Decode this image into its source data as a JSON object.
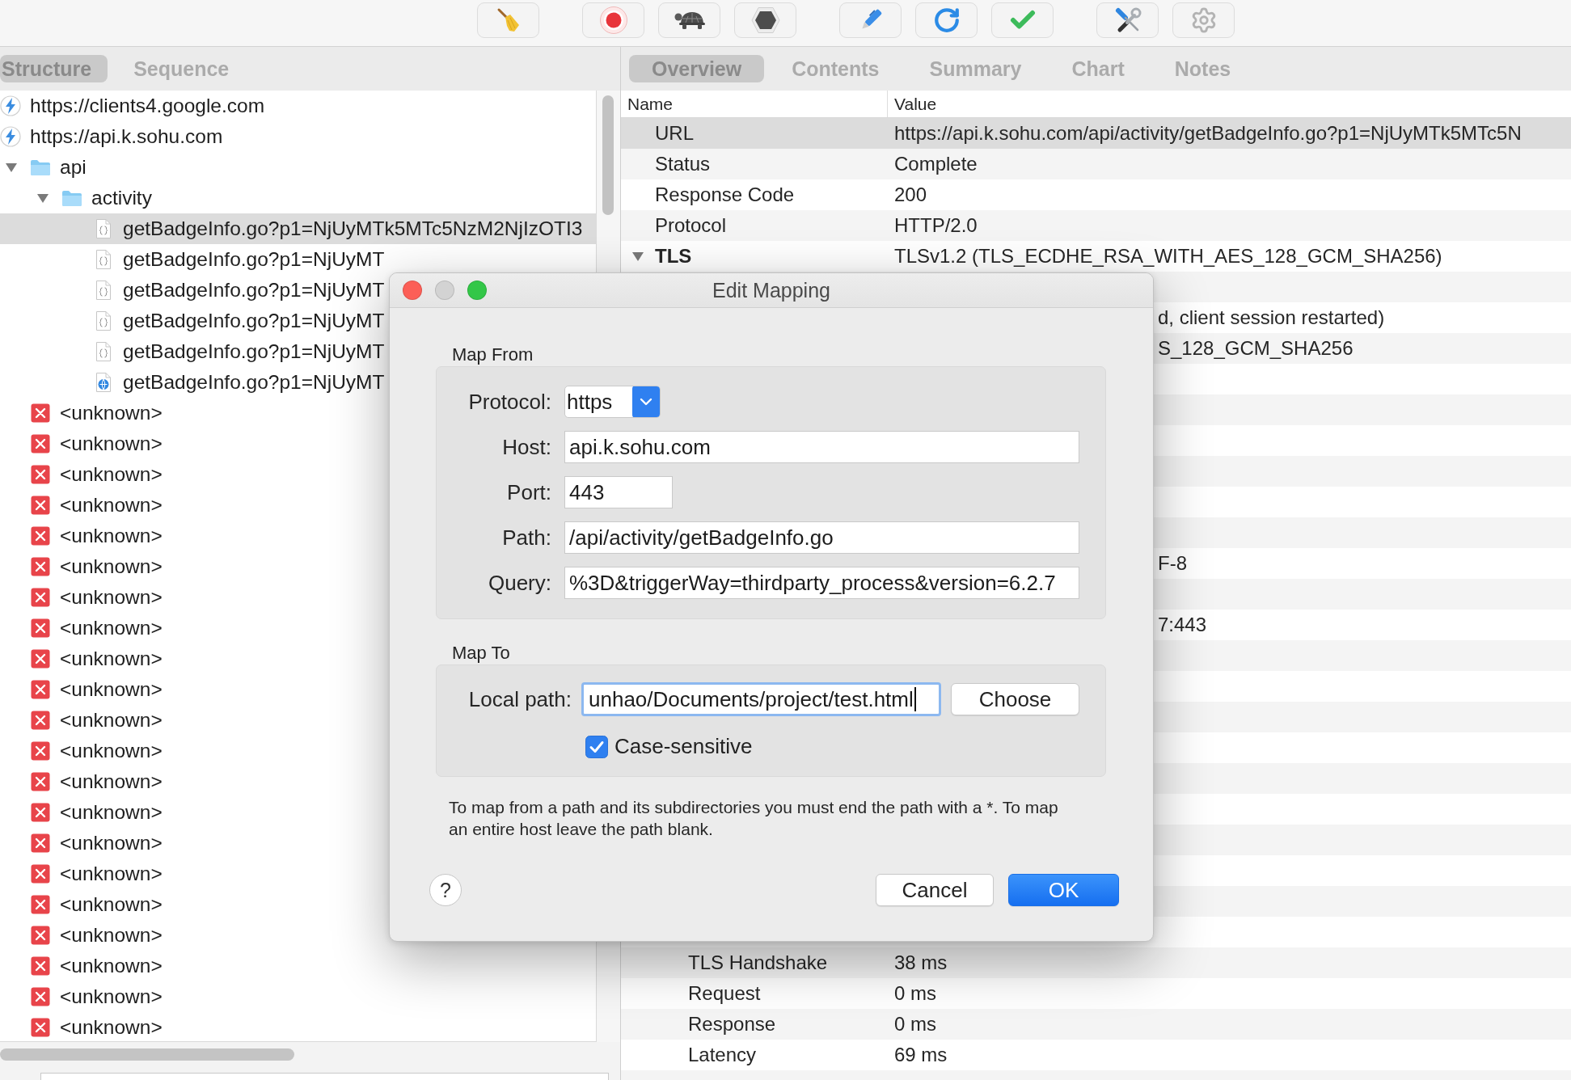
{
  "left_panel": {
    "tabs": [
      {
        "label": "Structure",
        "selected": true
      },
      {
        "label": "Sequence",
        "selected": false
      }
    ],
    "tree": [
      {
        "kind": "host",
        "label": "https://clients4.google.com",
        "selected": false
      },
      {
        "kind": "host",
        "label": "https://api.k.sohu.com",
        "selected": false,
        "children": [
          {
            "kind": "folder",
            "label": "api",
            "expanded": true,
            "selected": false,
            "children": [
              {
                "kind": "folder",
                "label": "activity",
                "expanded": true,
                "selected": false,
                "children": [
                  {
                    "kind": "json",
                    "label": "getBadgeInfo.go?p1=NjUyMTk5MTc5NzM2NjIzOTI3",
                    "selected": true
                  },
                  {
                    "kind": "json",
                    "label": "getBadgeInfo.go?p1=NjUyMT",
                    "selected": false
                  },
                  {
                    "kind": "json",
                    "label": "getBadgeInfo.go?p1=NjUyMT",
                    "selected": false
                  },
                  {
                    "kind": "json",
                    "label": "getBadgeInfo.go?p1=NjUyMT",
                    "selected": false
                  },
                  {
                    "kind": "json",
                    "label": "getBadgeInfo.go?p1=NjUyMT",
                    "selected": false
                  },
                  {
                    "kind": "web",
                    "label": "getBadgeInfo.go?p1=NjUyMT",
                    "selected": false
                  }
                ]
              }
            ]
          }
        ]
      },
      {
        "kind": "unknown",
        "label": "<unknown>",
        "selected": false
      },
      {
        "kind": "unknown",
        "label": "<unknown>",
        "selected": false
      },
      {
        "kind": "unknown",
        "label": "<unknown>",
        "selected": false
      },
      {
        "kind": "unknown",
        "label": "<unknown>",
        "selected": false
      },
      {
        "kind": "unknown",
        "label": "<unknown>",
        "selected": false
      },
      {
        "kind": "unknown",
        "label": "<unknown>",
        "selected": false
      },
      {
        "kind": "unknown",
        "label": "<unknown>",
        "selected": false
      },
      {
        "kind": "unknown",
        "label": "<unknown>",
        "selected": false
      },
      {
        "kind": "unknown",
        "label": "<unknown>",
        "selected": false
      },
      {
        "kind": "unknown",
        "label": "<unknown>",
        "selected": false
      },
      {
        "kind": "unknown",
        "label": "<unknown>",
        "selected": false
      },
      {
        "kind": "unknown",
        "label": "<unknown>",
        "selected": false
      },
      {
        "kind": "unknown",
        "label": "<unknown>",
        "selected": false
      },
      {
        "kind": "unknown",
        "label": "<unknown>",
        "selected": false
      },
      {
        "kind": "unknown",
        "label": "<unknown>",
        "selected": false
      },
      {
        "kind": "unknown",
        "label": "<unknown>",
        "selected": false
      },
      {
        "kind": "unknown",
        "label": "<unknown>",
        "selected": false
      },
      {
        "kind": "unknown",
        "label": "<unknown>",
        "selected": false
      },
      {
        "kind": "unknown",
        "label": "<unknown>",
        "selected": false
      },
      {
        "kind": "unknown",
        "label": "<unknown>",
        "selected": false
      },
      {
        "kind": "unknown",
        "label": "<unknown>",
        "selected": false
      }
    ]
  },
  "right_panel": {
    "tabs": [
      {
        "label": "Overview",
        "selected": true
      },
      {
        "label": "Contents",
        "selected": false
      },
      {
        "label": "Summary",
        "selected": false
      },
      {
        "label": "Chart",
        "selected": false
      },
      {
        "label": "Notes",
        "selected": false
      }
    ],
    "table": {
      "columns": [
        "Name",
        "Value"
      ],
      "rows": [
        {
          "name": "URL",
          "value": "https://api.k.sohu.com/api/activity/getBadgeInfo.go?p1=NjUyMTk5MTc5N",
          "selected": true
        },
        {
          "name": "Status",
          "value": "Complete",
          "selected": false
        },
        {
          "name": "Response Code",
          "value": "200",
          "selected": false
        },
        {
          "name": "Protocol",
          "value": "HTTP/2.0",
          "selected": false
        },
        {
          "name": "TLS",
          "value": "TLSv1.2 (TLS_ECDHE_RSA_WITH_AES_128_GCM_SHA256)",
          "expanded": true,
          "selected": false
        },
        {
          "selected": false
        },
        {
          "value": "d, client session restarted)",
          "selected": false
        },
        {
          "value": "S_128_GCM_SHA256",
          "selected": false
        },
        {
          "selected": false
        },
        {
          "selected": false
        },
        {
          "selected": false
        },
        {
          "selected": false
        },
        {
          "selected": false
        },
        {
          "selected": false
        },
        {
          "value": "F-8",
          "selected": false
        },
        {
          "selected": false
        },
        {
          "value": "7:443",
          "selected": false
        },
        {
          "selected": false
        },
        {
          "selected": false
        },
        {
          "selected": false
        },
        {
          "selected": false
        },
        {
          "selected": false
        },
        {
          "selected": false
        },
        {
          "selected": false
        },
        {
          "selected": false
        },
        {
          "selected": false
        },
        {
          "selected": false,
          "children": [
            {
              "name": "TLS Handshake",
              "value": "38 ms",
              "selected": false
            },
            {
              "name": "Request",
              "value": "0 ms",
              "selected": false
            },
            {
              "name": "Response",
              "value": "0 ms",
              "selected": false
            },
            {
              "name": "Latency",
              "value": "69 ms",
              "selected": false
            }
          ]
        }
      ]
    }
  },
  "dialog": {
    "title": "Edit Mapping",
    "map_from": {
      "title": "Map From",
      "protocol": {
        "label": "Protocol:",
        "value": "https"
      },
      "host": {
        "label": "Host:",
        "value": "api.k.sohu.com"
      },
      "port": {
        "label": "Port:",
        "value": "443"
      },
      "path": {
        "label": "Path:",
        "value": "/api/activity/getBadgeInfo.go"
      },
      "query": {
        "label": "Query:",
        "value": "%3D&triggerWay=thirdparty_process&version=6.2.7"
      }
    },
    "map_to": {
      "title": "Map To",
      "local_path": {
        "label": "Local path:",
        "value": "unhao/Documents/project/test.html",
        "focused": true
      },
      "choose_button": "Choose",
      "case_sensitive": {
        "label": "Case-sensitive",
        "checked": true
      }
    },
    "help_text": "To map from a path and its subdirectories you must end the path with a *. To map an entire host leave the path blank.",
    "help_button": "?",
    "buttons": [
      {
        "label": "Cancel",
        "default": false
      },
      {
        "label": "OK",
        "default": true
      }
    ]
  }
}
